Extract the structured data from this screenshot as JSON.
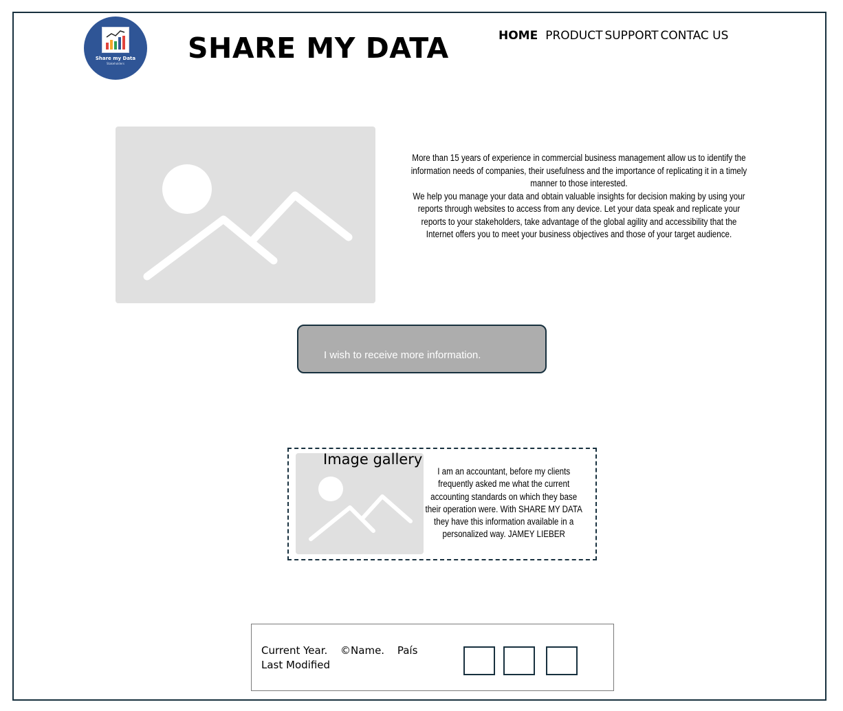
{
  "header": {
    "logo": {
      "name": "Share my Data",
      "tagline": "Stakeholders"
    },
    "title": "SHARE MY DATA",
    "nav": [
      "HOME",
      "PRODUCT",
      "SUPPORT",
      "CONTAC US"
    ]
  },
  "hero": {
    "image_icon": "image-placeholder-icon",
    "paragraph1": "More than 15 years of experience in commercial business management allow us to identify the information needs of companies, their usefulness and the importance of replicating it in a timely manner to those interested.",
    "paragraph2": "We help you manage your data and obtain valuable insights for decision making by using your reports through websites to access from any device.   Let your data speak and replicate your reports to your stakeholders, take advantage of the global agility and accessibility that the Internet offers you to meet your business objectives and those of your target audience."
  },
  "cta": {
    "label": "I wish to receive more information."
  },
  "gallery": {
    "title": "Image gallery",
    "image_icon": "image-placeholder-icon",
    "testimonial": "I am an accountant, before my clients frequently asked me what the current accounting standards on which they base their operation were. With SHARE MY DATA they have this information available in a personalized way. JAMEY LIEBER"
  },
  "footer": {
    "current_year": "Current Year.",
    "name": "©Name.",
    "country": "País",
    "last_modified": "Last Modified",
    "social_icons": [
      "social-icon-1",
      "social-icon-2",
      "social-icon-3"
    ]
  },
  "colors": {
    "frame": "#17303e",
    "logo_bg": "#2f5596",
    "placeholder": "#e0e0e0",
    "button": "#adadad"
  }
}
